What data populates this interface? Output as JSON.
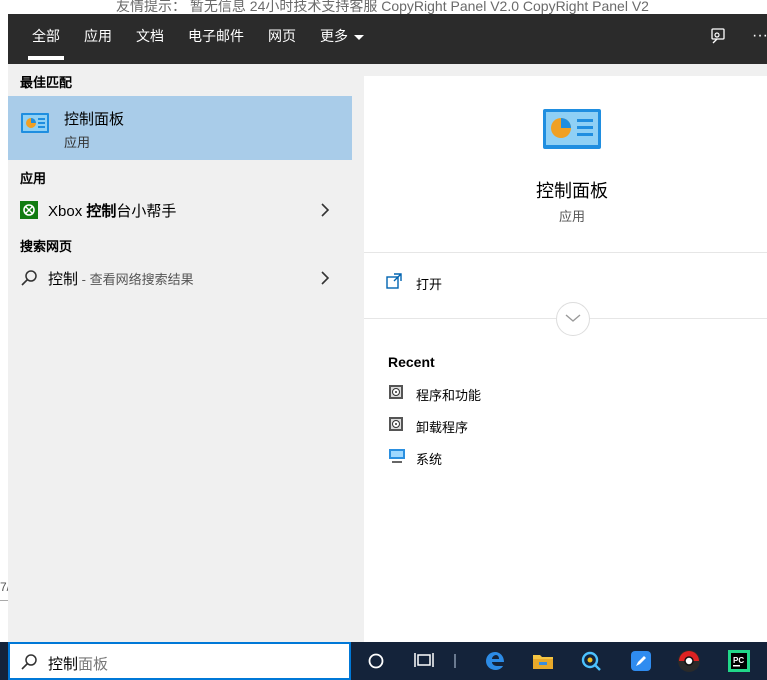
{
  "background": {
    "top_text": "友情提示：  暂无信息 24小时技术支持客服 CopyRight Panel V2.0 CopyRight Panel V2",
    "left_fragment": "7/"
  },
  "tabs": [
    {
      "label": "全部",
      "active": true
    },
    {
      "label": "应用"
    },
    {
      "label": "文档"
    },
    {
      "label": "电子邮件"
    },
    {
      "label": "网页"
    },
    {
      "label": "更多"
    }
  ],
  "header_icons": [
    "feedback-icon",
    "more-options-icon"
  ],
  "more_symbol": "···",
  "sections": {
    "best_match": "最佳匹配",
    "apps": "应用",
    "web": "搜索网页"
  },
  "best_match": {
    "title": "控制面板",
    "subtitle": "应用",
    "icon": "control-panel-icon"
  },
  "apps": [
    {
      "label_prefix": "Xbox ",
      "label_bold": "控制",
      "label_rest": "台小帮手",
      "icon": "xbox-icon"
    }
  ],
  "web": [
    {
      "term": "控制",
      "suffix": " - 查看网络搜索结果",
      "icon": "search-icon"
    }
  ],
  "preview": {
    "title": "控制面板",
    "subtitle": "应用",
    "open_label": "打开",
    "recent_title": "Recent",
    "recent": [
      {
        "label": "程序和功能",
        "icon": "programs-features-icon"
      },
      {
        "label": "卸载程序",
        "icon": "uninstall-program-icon"
      },
      {
        "label": "系统",
        "icon": "system-icon"
      }
    ]
  },
  "taskbar": {
    "query_typed": "控制",
    "query_hint": "面板",
    "icons": [
      "cortana-icon",
      "task-view-icon",
      "edge-icon",
      "file-explorer-icon",
      "photos-icon",
      "notes-icon",
      "media-player-icon",
      "pycharm-icon"
    ]
  },
  "colors": {
    "topbar": "#2b2b2b",
    "selection": "#a9cce9",
    "taskbar": "#14233a",
    "search_border": "#0078d7"
  }
}
